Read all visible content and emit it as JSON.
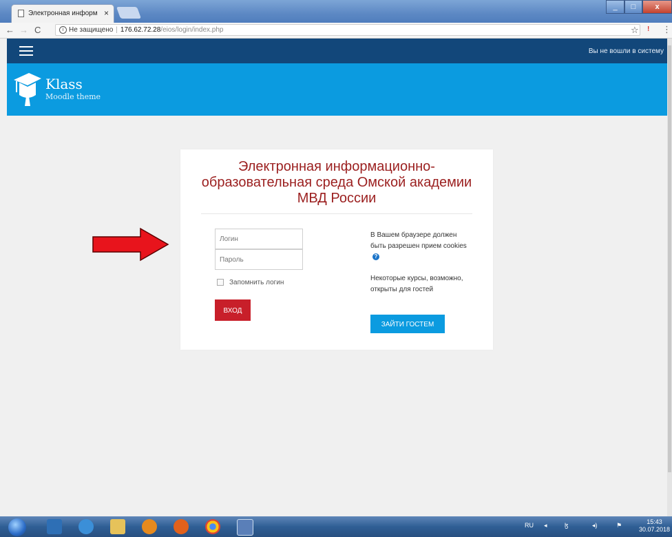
{
  "browser": {
    "tab_title": "Электронная информац",
    "tab_close": "×",
    "back": "←",
    "forward": "→",
    "reload": "C",
    "security_label": "Не защищено",
    "url_host": "176.62.72.28",
    "url_path": "/eios/login/index.php",
    "star": "☆",
    "menu": "⋮",
    "minimize": "_",
    "maximize": "□",
    "close": "x"
  },
  "navbar": {
    "login_status": "Вы не вошли в систему"
  },
  "brand": {
    "name": "Klass",
    "subtitle": "Moodle theme"
  },
  "login": {
    "title": "Электронная информационно-образовательная среда Омской академии МВД России",
    "username_placeholder": "Логин",
    "password_placeholder": "Пароль",
    "remember_label": "Запомнить логин",
    "login_button": "ВХОД",
    "cookies_text": "В Вашем браузере должен быть разрешен прием cookies",
    "guest_text": "Некоторые курсы, возможно, открыты для гостей",
    "guest_button": "ЗАЙТИ ГОСТЕМ"
  },
  "taskbar": {
    "language": "RU",
    "time": "15:43",
    "date": "30.07.2018"
  },
  "colors": {
    "navbar": "#12477a",
    "brandbar": "#0b9be0",
    "title_text": "#9b1f1f",
    "login_button": "#c81f2a",
    "guest_button": "#0b9be0",
    "arrow": "#e8141c"
  }
}
